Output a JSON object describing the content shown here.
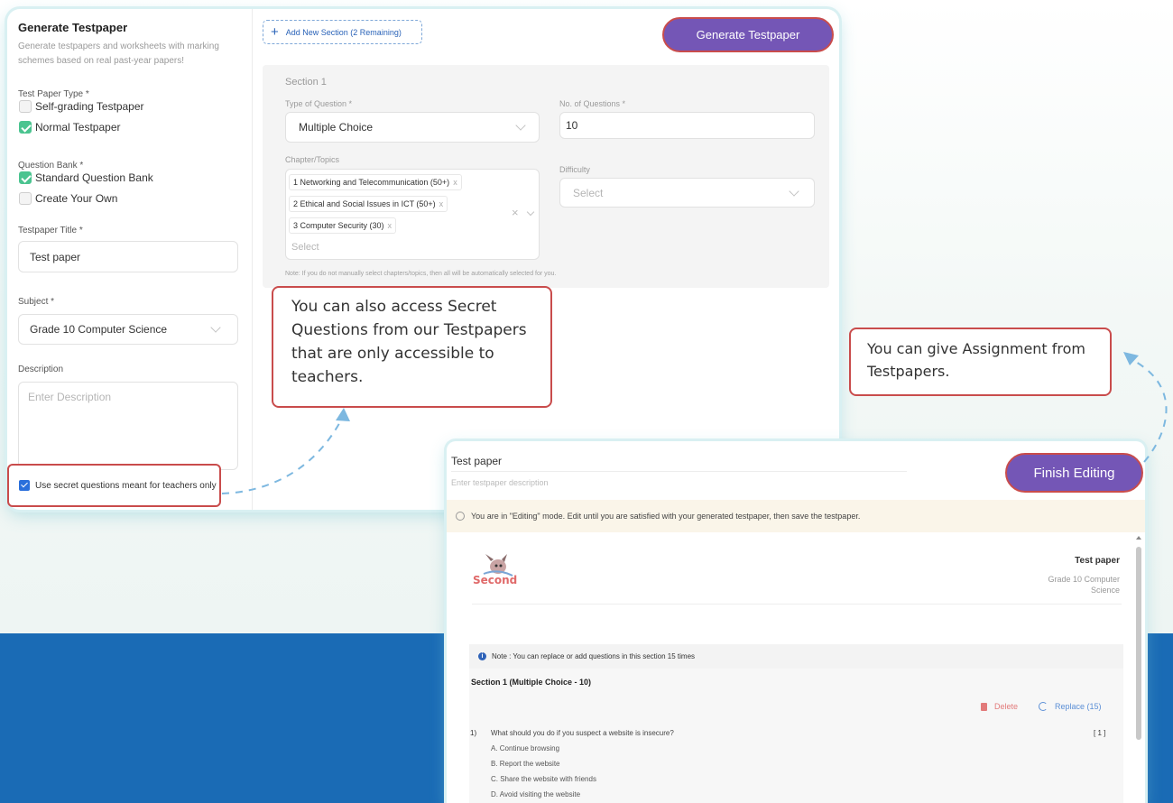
{
  "form": {
    "title": "Generate Testpaper",
    "description": "Generate testpapers and worksheets with marking schemes based on real past-year papers!",
    "paper_type_label": "Test Paper Type *",
    "paper_types": [
      "Self-grading Testpaper",
      "Normal Testpaper"
    ],
    "question_bank_label": "Question Bank *",
    "question_banks": [
      "Standard Question Bank",
      "Create Your Own"
    ],
    "title_label": "Testpaper Title *",
    "title_value": "Test paper",
    "subject_label": "Subject *",
    "subject_value": "Grade 10 Computer Science",
    "description_label": "Description",
    "description_placeholder": "Enter Description",
    "secret_label": "Use secret questions meant for teachers only"
  },
  "toolbar": {
    "add_section": "Add New Section  (2 Remaining)",
    "generate": "Generate Testpaper"
  },
  "section": {
    "title": "Section 1",
    "type_label": "Type of Question *",
    "type_value": "Multiple Choice",
    "count_label": "No. of Questions *",
    "count_value": "10",
    "chapters_label": "Chapter/Topics",
    "chapters": [
      "1 Networking and Telecommunication (50+)",
      "2 Ethical and Social Issues in ICT (50+)",
      "3 Computer Security (30)"
    ],
    "chapters_placeholder": "Select",
    "difficulty_label": "Difficulty",
    "difficulty_placeholder": "Select",
    "note": "Note: If you do not manually select chapters/topics, then all will be automatically selected for you."
  },
  "callouts": {
    "secret": "You can also access Secret Questions from our Testpapers that are only accessible to teachers.",
    "assignment": "You can give Assignment from Testpapers."
  },
  "editor": {
    "title": "Test paper",
    "desc_placeholder": "Enter testpaper description",
    "finish": "Finish Editing",
    "banner": "You are in \"Editing\" mode. Edit until you are satisfied with your generated testpaper, then save the testpaper.",
    "logo_text": "Second",
    "paper_title": "Test paper",
    "paper_subject": "Grade 10 Computer Science",
    "note": "Note : You can replace or add questions in this section 15 times",
    "section_head": "Section 1 (Multiple Choice - 10)",
    "delete": "Delete",
    "replace": "Replace (15)",
    "question": {
      "number": "1)",
      "text": "What should you do if you suspect a website is insecure?",
      "marks": "[ 1 ]",
      "options": [
        "A. Continue browsing",
        "B. Report the website",
        "C. Share the website with friends",
        "D. Avoid visiting the website"
      ]
    }
  },
  "colors": {
    "accent": "#7456b6",
    "highlight_border": "#c94c4c",
    "check_green": "#4bc490",
    "band_blue": "#1a6bb5"
  }
}
